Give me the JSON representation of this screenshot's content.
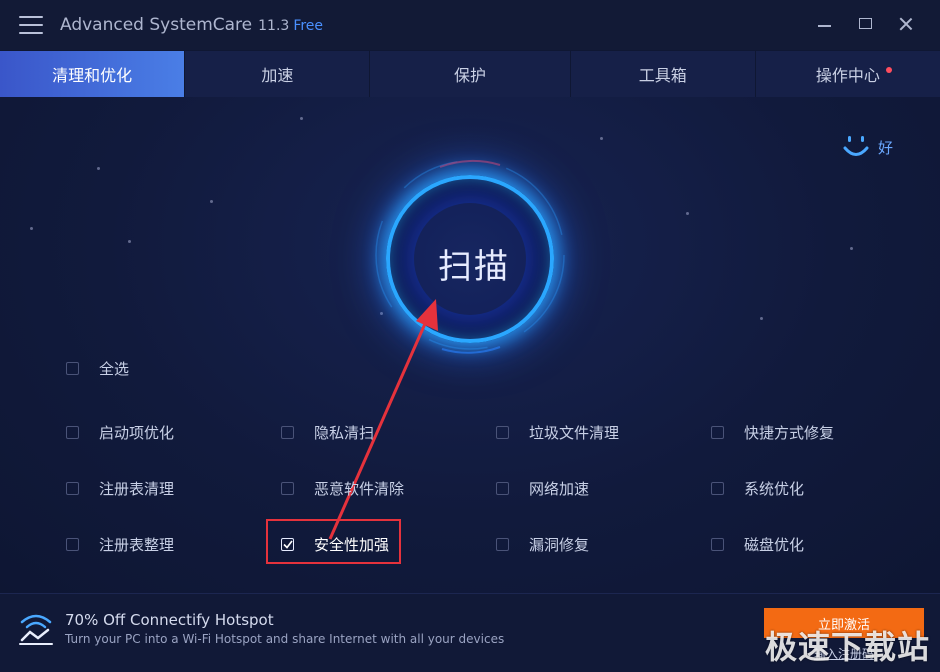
{
  "app": {
    "title": "Advanced SystemCare",
    "version": "11.3",
    "edition": "Free"
  },
  "tabs": [
    {
      "label": "清理和优化",
      "active": true
    },
    {
      "label": "加速",
      "active": false
    },
    {
      "label": "保护",
      "active": false
    },
    {
      "label": "工具箱",
      "active": false
    },
    {
      "label": "操作中心",
      "active": false,
      "notification": true
    }
  ],
  "status": {
    "mood_label": "好"
  },
  "scan": {
    "label": "扫描"
  },
  "select_all": {
    "label": "全选",
    "checked": false
  },
  "options": [
    {
      "label": "启动项优化",
      "checked": false
    },
    {
      "label": "隐私清扫",
      "checked": false
    },
    {
      "label": "垃圾文件清理",
      "checked": false
    },
    {
      "label": "快捷方式修复",
      "checked": false
    },
    {
      "label": "注册表清理",
      "checked": false
    },
    {
      "label": "恶意软件清除",
      "checked": false
    },
    {
      "label": "网络加速",
      "checked": false
    },
    {
      "label": "系统优化",
      "checked": false
    },
    {
      "label": "注册表整理",
      "checked": false
    },
    {
      "label": "安全性加强",
      "checked": true
    },
    {
      "label": "漏洞修复",
      "checked": false
    },
    {
      "label": "磁盘优化",
      "checked": false
    }
  ],
  "footer": {
    "promo_title": "70% Off Connectify Hotspot",
    "promo_desc": "Turn your PC into a Wi-Fi Hotspot and share Internet with all your devices",
    "activate_label": "立即激活",
    "register_label": "输入注册码",
    "watermark": "极速下载站"
  },
  "colors": {
    "accent": "#2aa7ff",
    "activate": "#f36a13",
    "annotation": "#e5323c"
  }
}
